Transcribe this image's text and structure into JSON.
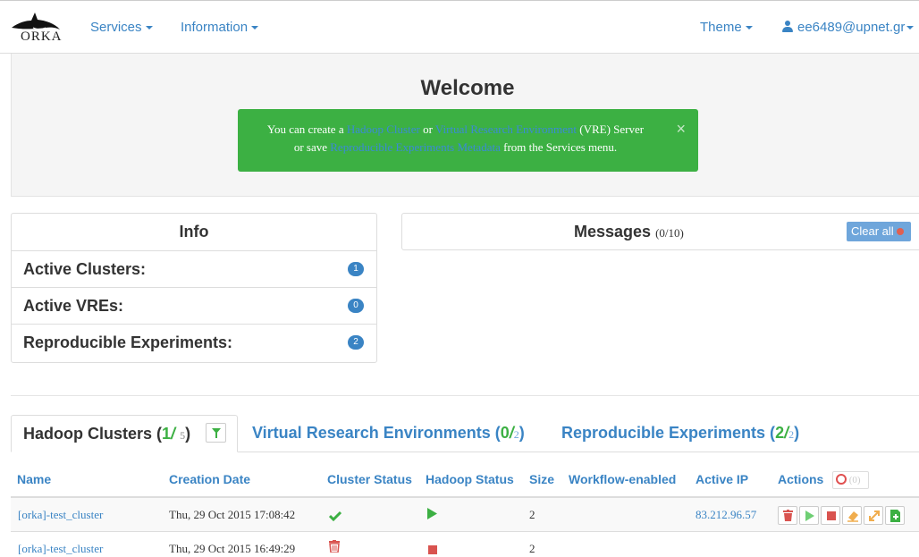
{
  "navbar": {
    "brand": "ORKA",
    "services_label": "Services",
    "information_label": "Information",
    "theme_label": "Theme",
    "user_label": "ee6489@upnet.gr"
  },
  "welcome": {
    "title": "Welcome",
    "alert_text_1": "You can create a ",
    "link_hadoop": "Hadoop Cluster",
    "alert_text_2": " or ",
    "link_vre": "Virtual Research Environment",
    "alert_text_3": " (VRE) Server",
    "alert_text_4": "or save ",
    "link_metadata": "Reproducible Experiments Metadata",
    "alert_text_5": " from the Services menu.",
    "close": "×"
  },
  "info": {
    "title": "Info",
    "rows": [
      {
        "label": "Active Clusters:",
        "count": "1"
      },
      {
        "label": "Active VREs:",
        "count": "0"
      },
      {
        "label": "Reproducible Experiments:",
        "count": "2"
      }
    ]
  },
  "messages": {
    "title": "Messages",
    "count": "(0/10)",
    "clear_label": "Clear all"
  },
  "tabs": [
    {
      "label": "Hadoop Clusters (",
      "active": "1",
      "slash": "/",
      "total": "5",
      "close": ")"
    },
    {
      "label": "Virtual Research Environments (",
      "active": "0",
      "slash": "/",
      "total": "2",
      "close": ")"
    },
    {
      "label": "Reproducible Experiments (",
      "active": "2",
      "slash": "/",
      "total": "2",
      "close": ")"
    }
  ],
  "table": {
    "headers": [
      "Name",
      "Creation Date",
      "Cluster Status",
      "Hadoop Status",
      "Size",
      "Workflow-enabled",
      "Active IP",
      "Actions"
    ],
    "actions_count": "(0)",
    "rows": [
      {
        "name": "[orka]-test_cluster",
        "date": "Thu, 29 Oct 2015 17:08:42",
        "cluster_status": "check-icon",
        "hadoop_status": "play-icon",
        "size": "2",
        "workflow": "",
        "ip": "83.212.96.57"
      },
      {
        "name": "[orka]-test_cluster",
        "date": "Thu, 29 Oct 2015 16:49:29",
        "cluster_status": "trash-icon",
        "hadoop_status": "stop-icon",
        "size": "2",
        "workflow": "",
        "ip": ""
      }
    ]
  },
  "colors": {
    "accent": "#3a84c4",
    "success": "#3cb043",
    "danger": "#d9534f",
    "warning": "#f0ad4e"
  }
}
